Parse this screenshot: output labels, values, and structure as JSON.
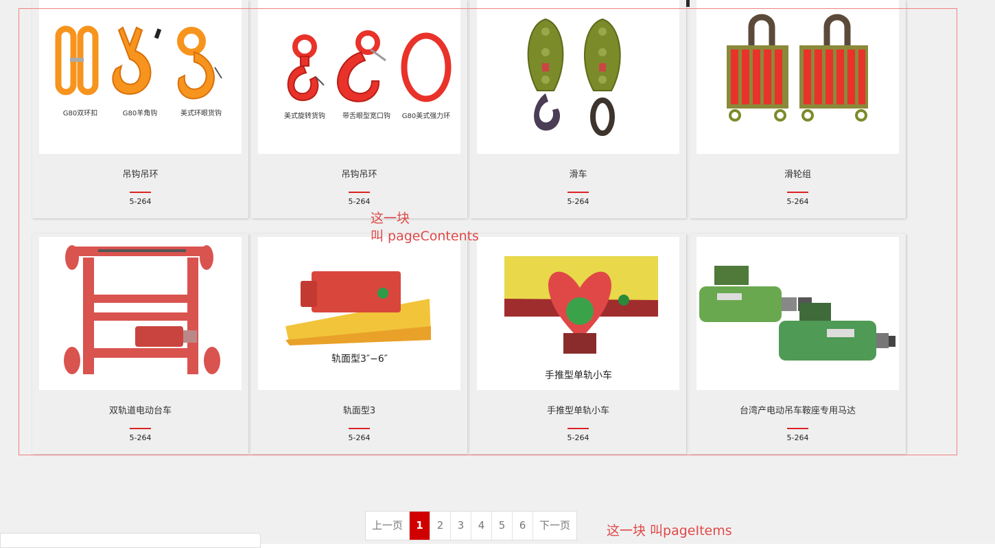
{
  "products": [
    {
      "name": "吊钩吊环",
      "code": "5-264",
      "image_captions": [
        "G80双环扣",
        "G80羊角钩",
        "美式环眼货钩"
      ]
    },
    {
      "name": "吊钩吊环",
      "code": "5-264",
      "image_captions": [
        "美式旋转货钩",
        "带舌眼型宽口钩",
        "G80美式强力环"
      ]
    },
    {
      "name": "滑车",
      "code": "5-264",
      "image_captions": []
    },
    {
      "name": "滑轮组",
      "code": "5-264",
      "image_captions": []
    },
    {
      "name": "双轨道电动台车",
      "code": "5-264",
      "image_captions": []
    },
    {
      "name": "轨面型3",
      "code": "5-264",
      "image_captions": [
        "轨面型3″−6″"
      ]
    },
    {
      "name": "手推型单轨小车",
      "code": "5-264",
      "image_captions": [
        "手推型单轨小车"
      ]
    },
    {
      "name": "台湾产电动吊车鞍座专用马达",
      "code": "5-264",
      "image_captions": []
    }
  ],
  "annotations": {
    "page_contents": [
      "这一块",
      "叫 pageContents"
    ],
    "page_items": "这一块 叫pageItems"
  },
  "pagination": {
    "prev": "上一页",
    "pages": [
      "1",
      "2",
      "3",
      "4",
      "5",
      "6"
    ],
    "active_page": "1",
    "next": "下一页"
  },
  "colors": {
    "accent_red": "#d10000",
    "annotation_red": "#e04848",
    "annotation_border": "#f08080"
  }
}
